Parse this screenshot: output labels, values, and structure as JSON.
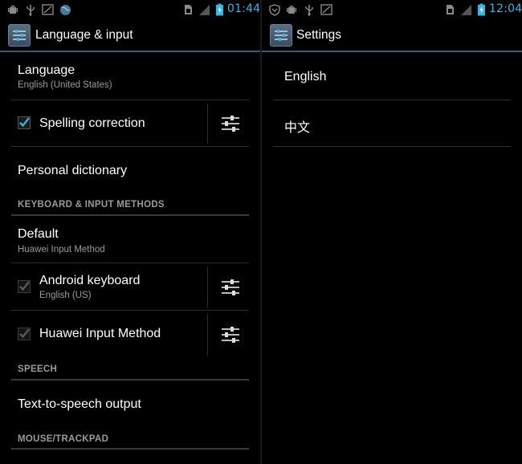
{
  "left": {
    "status": {
      "time": "01:44"
    },
    "actionbar": {
      "title": "Language & input"
    },
    "language": {
      "title": "Language",
      "summary": "English (United States)"
    },
    "spelling": {
      "title": "Spelling correction",
      "checked": true
    },
    "personal_dictionary": {
      "title": "Personal dictionary"
    },
    "keyboard_header": "KEYBOARD & INPUT METHODS",
    "default": {
      "title": "Default",
      "summary": "Huawei Input Method"
    },
    "android_keyboard": {
      "title": "Android keyboard",
      "summary": "English (US)",
      "checked": true
    },
    "huawei_input": {
      "title": "Huawei Input Method",
      "checked": true
    },
    "speech_header": "SPEECH",
    "tts": {
      "title": "Text-to-speech output"
    },
    "mouse_header": "MOUSE/TRACKPAD"
  },
  "right": {
    "status": {
      "time": "12:04"
    },
    "actionbar": {
      "title": "Settings"
    },
    "languages": [
      "English",
      "中文"
    ]
  },
  "colors": {
    "accent": "#33b5e5",
    "check_active": "#33b5e5",
    "check_dim": "#5a5a5a"
  }
}
